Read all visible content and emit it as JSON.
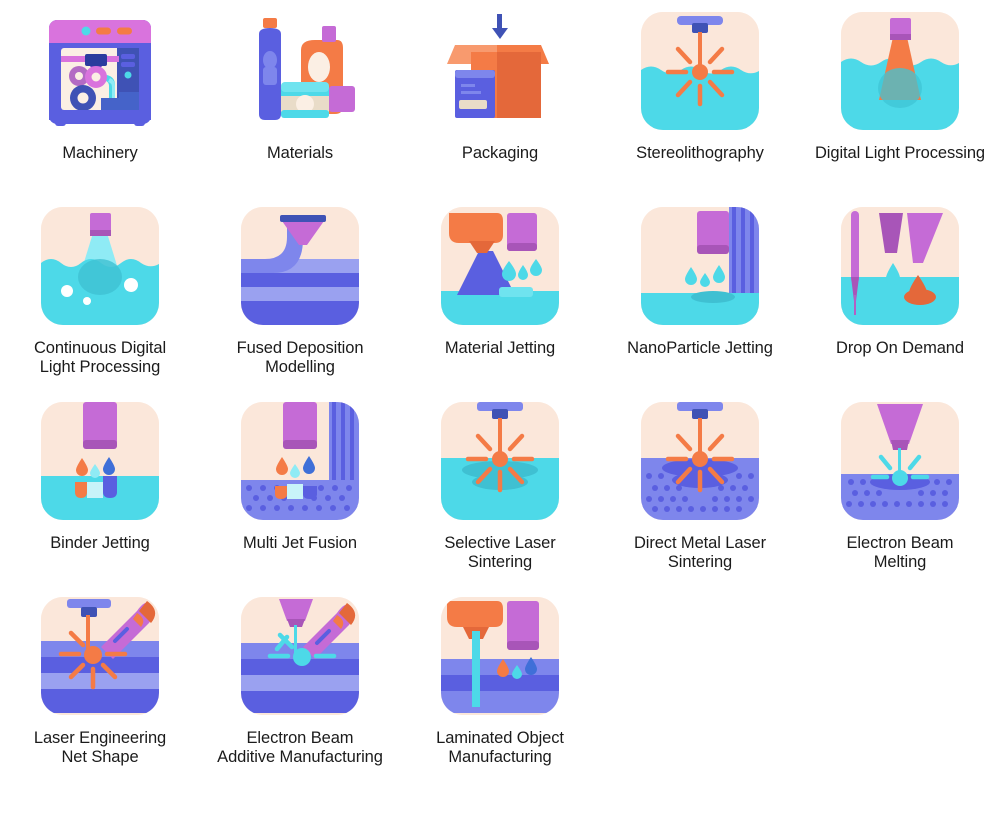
{
  "page": {
    "title": "3D Printing Technologies Icon Set",
    "background_color": "#FFFFFF",
    "columns": 5,
    "rows": 4,
    "item_count": 18
  },
  "palette": {
    "tile_peach": "#FBE7DA",
    "cyan_liquid": "#4DD9E8",
    "cyan_light": "#6FE3EF",
    "orange": "#F47B46",
    "orange_dark": "#E4683A",
    "orange_light": "#F89A6E",
    "purple": "#C56BD6",
    "purple_dark": "#A855B8",
    "magenta": "#D973DD",
    "indigo": "#5A5FE0",
    "indigo_light": "#7E86EC",
    "indigo_pale": "#9AA1F0",
    "blue_drop": "#3F6FD8",
    "text": "#1B1B1B",
    "cream": "#FBEFE4"
  },
  "items": [
    {
      "id": "machinery",
      "label": "Machinery",
      "icon": "printer-machine-icon",
      "row": 1,
      "col": 1
    },
    {
      "id": "materials",
      "label": "Materials",
      "icon": "material-bottles-icon",
      "row": 1,
      "col": 2
    },
    {
      "id": "packaging",
      "label": "Packaging",
      "icon": "open-box-icon",
      "row": 1,
      "col": 3
    },
    {
      "id": "stereolithography",
      "label": "Stereolithography",
      "icon": "laser-resin-vat-icon",
      "row": 1,
      "col": 4
    },
    {
      "id": "digital-light-processing",
      "label": "Digital Light Processing",
      "icon": "projector-cone-icon",
      "row": 1,
      "col": 5
    },
    {
      "id": "continuous-digital-light-processing",
      "label": "Continuous Digital\nLight Processing",
      "icon": "cone-bubbles-vat-icon",
      "row": 2,
      "col": 1
    },
    {
      "id": "fused-deposition-modelling",
      "label": "Fused Deposition\nModelling",
      "icon": "funnel-extruder-icon",
      "row": 2,
      "col": 2
    },
    {
      "id": "material-jetting",
      "label": "Material Jetting",
      "icon": "spray-head-droplets-icon",
      "row": 2,
      "col": 3
    },
    {
      "id": "nanoparticle-jetting",
      "label": "NanoParticle Jetting",
      "icon": "nozzle-droplets-stripes-icon",
      "row": 2,
      "col": 4
    },
    {
      "id": "drop-on-demand",
      "label": "Drop On Demand",
      "icon": "dual-nozzle-drop-icon",
      "row": 2,
      "col": 5
    },
    {
      "id": "binder-jetting",
      "label": "Binder Jetting",
      "icon": "binder-nozzle-icon",
      "row": 3,
      "col": 1
    },
    {
      "id": "multi-jet-fusion",
      "label": "Multi Jet Fusion",
      "icon": "multijet-powder-icon",
      "row": 3,
      "col": 2
    },
    {
      "id": "selective-laser-sintering",
      "label": "Selective Laser\nSintering",
      "icon": "laser-burst-liquid-icon",
      "row": 3,
      "col": 3
    },
    {
      "id": "direct-metal-laser-sintering",
      "label": "Direct Metal Laser\nSintering",
      "icon": "laser-burst-powder-icon",
      "row": 3,
      "col": 4
    },
    {
      "id": "electron-beam-melting",
      "label": "Electron Beam\nMelting",
      "icon": "ebeam-funnel-icon",
      "row": 3,
      "col": 5
    },
    {
      "id": "laser-engineering-net-shape",
      "label": "Laser Engineering\nNet Shape",
      "icon": "lens-arm-burst-icon",
      "row": 4,
      "col": 1
    },
    {
      "id": "electron-beam-additive-manufacturing",
      "label": "Electron Beam\nAdditive Manufacturing",
      "icon": "ebam-arm-burst-icon",
      "row": 4,
      "col": 2
    },
    {
      "id": "laminated-object-manufacturing",
      "label": "Laminated Object\nManufacturing",
      "icon": "laminate-stream-icon",
      "row": 4,
      "col": 3
    }
  ]
}
